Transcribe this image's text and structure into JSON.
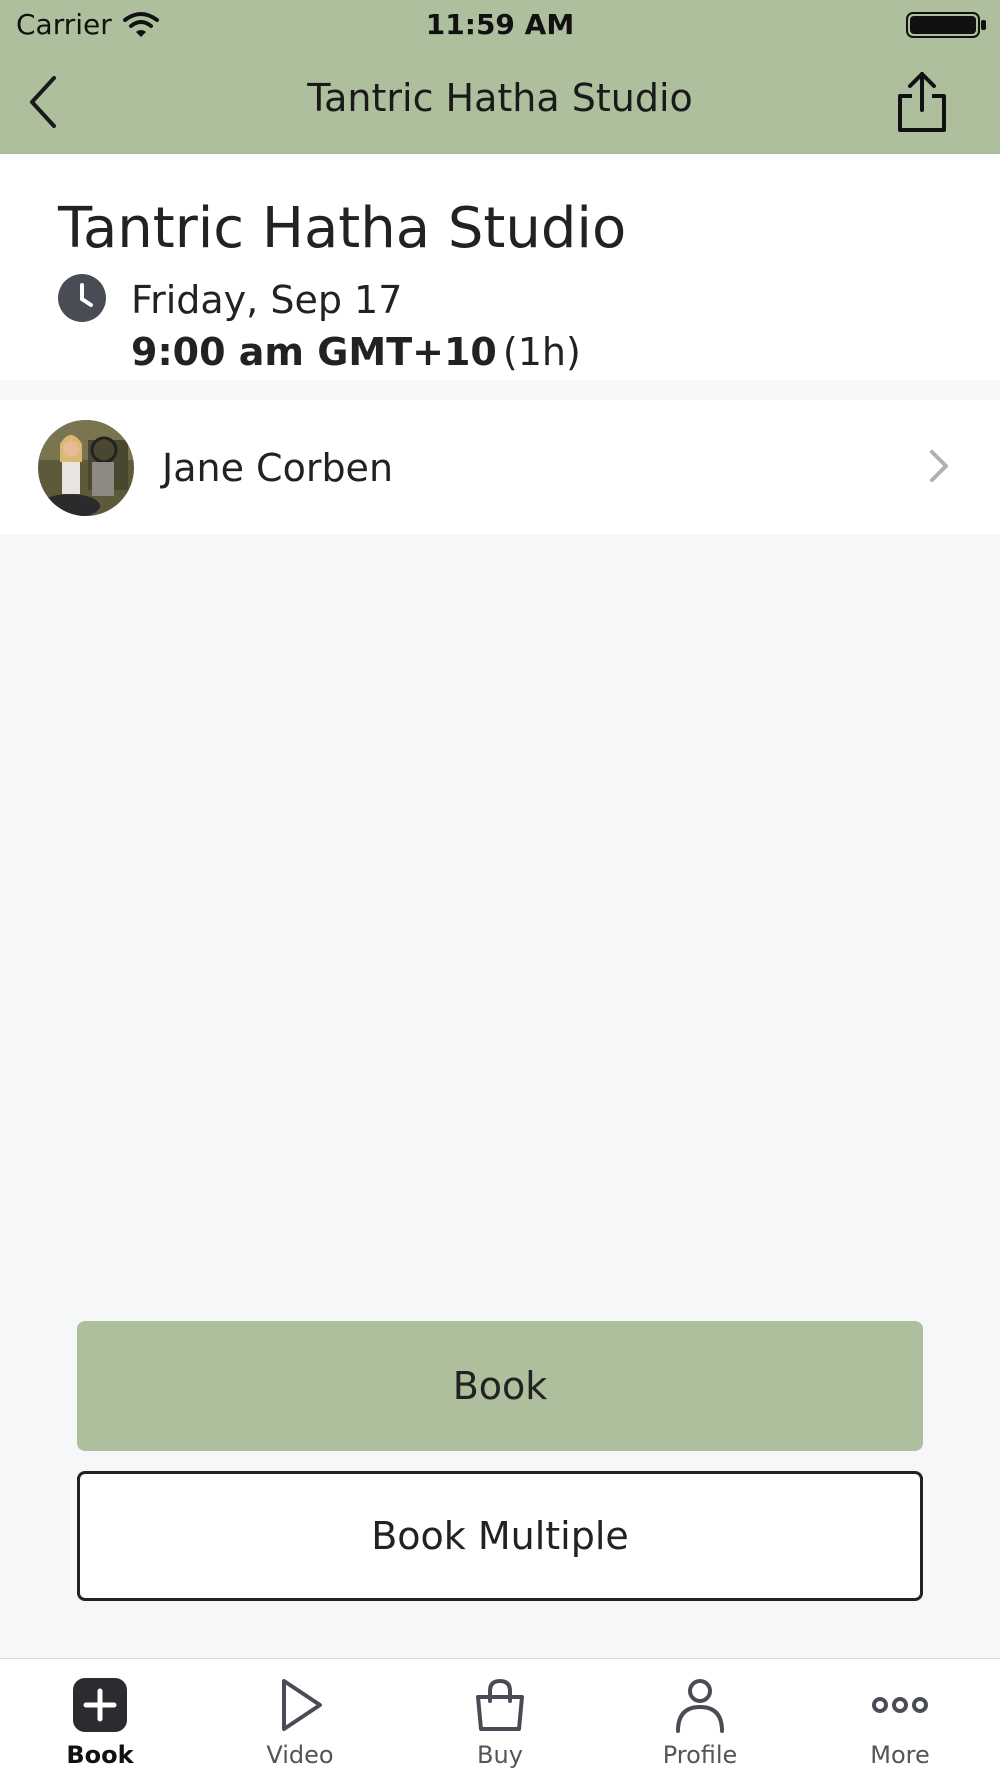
{
  "status_bar": {
    "carrier": "Carrier",
    "time": "11:59 AM"
  },
  "nav": {
    "title": "Tantric Hatha Studio",
    "back_icon": "chevron-left-icon",
    "share_icon": "share-icon"
  },
  "class_info": {
    "title": "Tantric Hatha Studio",
    "date": "Friday, Sep 17",
    "time": "9:00 am GMT+10",
    "duration": "(1h)"
  },
  "instructor": {
    "name": "Jane Corben"
  },
  "actions": {
    "book_label": "Book",
    "book_multiple_label": "Book Multiple"
  },
  "tabs": [
    {
      "label": "Book",
      "icon": "plus-square-icon",
      "active": true
    },
    {
      "label": "Video",
      "icon": "play-icon",
      "active": false
    },
    {
      "label": "Buy",
      "icon": "shopping-bag-icon",
      "active": false
    },
    {
      "label": "Profile",
      "icon": "person-icon",
      "active": false
    },
    {
      "label": "More",
      "icon": "more-dots-icon",
      "active": false
    }
  ],
  "colors": {
    "accent": "#adbf9d",
    "background": "#f6f7f9"
  }
}
